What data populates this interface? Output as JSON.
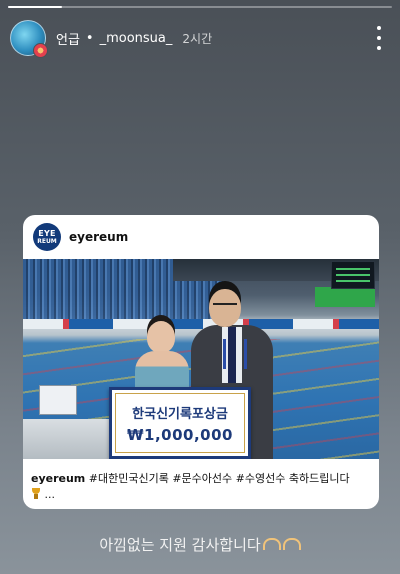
{
  "story": {
    "progress_fraction": 0.14,
    "header": {
      "mention_label": "언급",
      "separator": "•",
      "username": "_moonsua_",
      "time_ago": "2시간"
    },
    "shared_post": {
      "account": "eyereum",
      "logo_text_top": "EYE",
      "logo_text_bottom": "REUM",
      "photo": {
        "check_title": "한국신기록포상금",
        "check_amount": "₩1,000,000"
      },
      "caption_user": "eyereum",
      "caption_text": "#대한민국신기록 #문수아선수 #수영선수 축하드립니다",
      "caption_more": "..."
    },
    "story_text": "아낌없는 지원 감사합니다"
  },
  "icons": {
    "more": "more-vertical-icon",
    "trophy": "trophy-icon",
    "hands": "heart-hands-icon"
  }
}
